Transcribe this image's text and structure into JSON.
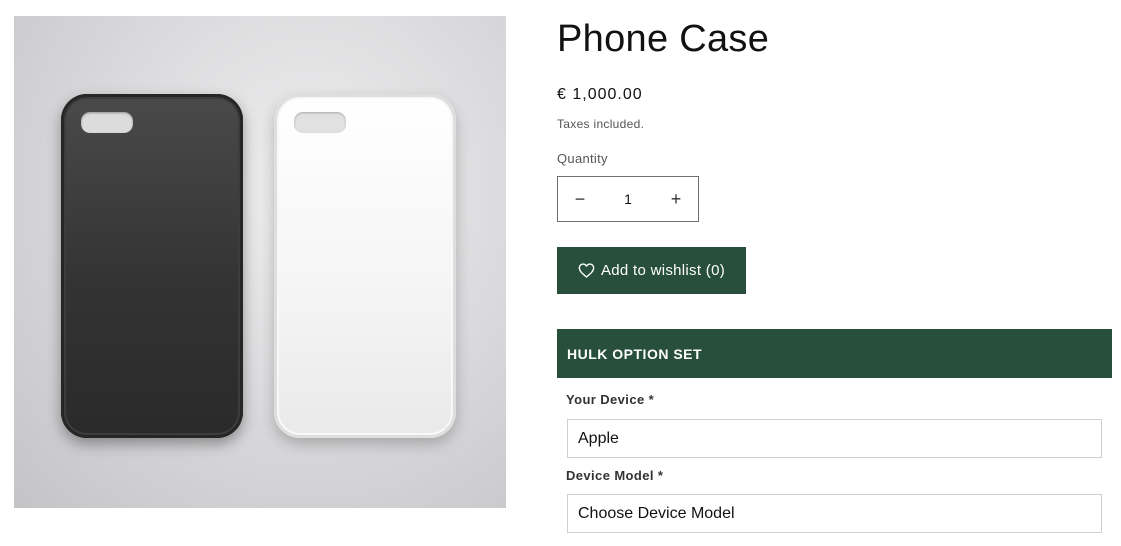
{
  "product": {
    "title": "Phone Case",
    "price": "€ 1,000.00",
    "tax_note": "Taxes included."
  },
  "media": {
    "alt": "Black and white phone cases"
  },
  "quantity": {
    "label": "Quantity",
    "value": "1",
    "decrease_symbol": "−",
    "increase_symbol": "+"
  },
  "wishlist": {
    "label": "Add to wishlist (0)",
    "icon": "heart-icon"
  },
  "option_set": {
    "header": "HULK OPTION SET",
    "fields": [
      {
        "label": "Your Device *",
        "value": "Apple"
      },
      {
        "label": "Device Model *",
        "value": "Choose Device Model"
      }
    ]
  },
  "colors": {
    "accent": "#274f3c",
    "text": "#121212",
    "muted": "#555555"
  }
}
